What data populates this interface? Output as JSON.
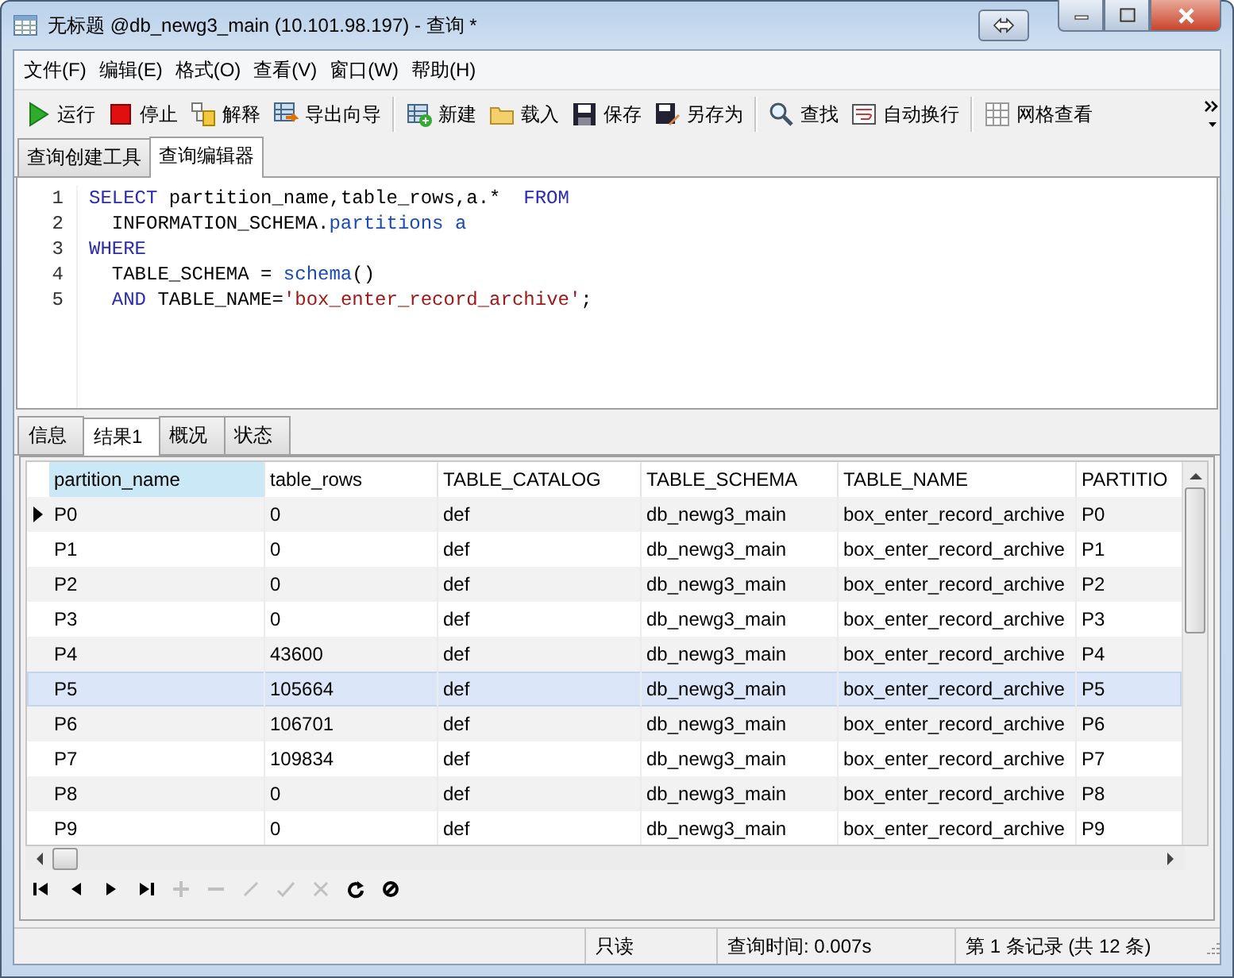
{
  "window": {
    "title": "无标题 @db_newg3_main (10.101.98.197) - 查询 *"
  },
  "menu": [
    "文件(F)",
    "编辑(E)",
    "格式(O)",
    "查看(V)",
    "窗口(W)",
    "帮助(H)"
  ],
  "toolbar": [
    {
      "kind": "run",
      "label": "运行"
    },
    {
      "kind": "stop",
      "label": "停止"
    },
    {
      "kind": "explain",
      "label": "解释"
    },
    {
      "kind": "export",
      "label": "导出向导"
    },
    {
      "kind": "sep"
    },
    {
      "kind": "new",
      "label": "新建"
    },
    {
      "kind": "load",
      "label": "载入"
    },
    {
      "kind": "save",
      "label": "保存"
    },
    {
      "kind": "saveas",
      "label": "另存为"
    },
    {
      "kind": "sep"
    },
    {
      "kind": "find",
      "label": "查找"
    },
    {
      "kind": "wrap",
      "label": "自动换行"
    },
    {
      "kind": "sep"
    },
    {
      "kind": "grid",
      "label": "网格查看"
    }
  ],
  "editor_tabs": [
    {
      "label": "查询创建工具",
      "selected": false
    },
    {
      "label": "查询编辑器",
      "selected": true
    }
  ],
  "editor": {
    "lines": [
      {
        "number": "1",
        "tokens": [
          {
            "kind": "keyword",
            "text": "SELECT"
          },
          {
            "kind": "plain",
            "text": " partition_name,table_rows,a.*  "
          },
          {
            "kind": "keyword",
            "text": "FROM"
          }
        ]
      },
      {
        "number": "2",
        "tokens": [
          {
            "kind": "plain",
            "text": "  INFORMATION_SCHEMA."
          },
          {
            "kind": "func",
            "text": "partitions a"
          }
        ]
      },
      {
        "number": "3",
        "tokens": [
          {
            "kind": "keyword",
            "text": "WHERE"
          }
        ]
      },
      {
        "number": "4",
        "tokens": [
          {
            "kind": "plain",
            "text": "  TABLE_SCHEMA = "
          },
          {
            "kind": "func",
            "text": "schema"
          },
          {
            "kind": "plain",
            "text": "()"
          }
        ]
      },
      {
        "number": "5",
        "tokens": [
          {
            "kind": "keyword",
            "text": "  AND"
          },
          {
            "kind": "plain",
            "text": " TABLE_NAME="
          },
          {
            "kind": "string",
            "text": "'box_enter_record_archive'"
          },
          {
            "kind": "plain",
            "text": ";"
          }
        ]
      }
    ]
  },
  "result_tabs": [
    {
      "label": "信息",
      "selected": false
    },
    {
      "label": "结果1",
      "selected": true
    },
    {
      "label": "概况",
      "selected": false
    },
    {
      "label": "状态",
      "selected": false
    }
  ],
  "table": {
    "columns": [
      {
        "label": "partition_name",
        "selected": true
      },
      {
        "label": "table_rows",
        "selected": false
      },
      {
        "label": "TABLE_CATALOG",
        "selected": false
      },
      {
        "label": "TABLE_SCHEMA",
        "selected": false
      },
      {
        "label": "TABLE_NAME",
        "selected": false
      },
      {
        "label": "PARTITIO",
        "selected": false
      }
    ],
    "rows": [
      {
        "current": true,
        "selected": false,
        "cells": [
          "P0",
          "0",
          "def",
          "db_newg3_main",
          "box_enter_record_archive",
          "P0"
        ]
      },
      {
        "current": false,
        "selected": false,
        "cells": [
          "P1",
          "0",
          "def",
          "db_newg3_main",
          "box_enter_record_archive",
          "P1"
        ]
      },
      {
        "current": false,
        "selected": false,
        "cells": [
          "P2",
          "0",
          "def",
          "db_newg3_main",
          "box_enter_record_archive",
          "P2"
        ]
      },
      {
        "current": false,
        "selected": false,
        "cells": [
          "P3",
          "0",
          "def",
          "db_newg3_main",
          "box_enter_record_archive",
          "P3"
        ]
      },
      {
        "current": false,
        "selected": false,
        "cells": [
          "P4",
          "43600",
          "def",
          "db_newg3_main",
          "box_enter_record_archive",
          "P4"
        ]
      },
      {
        "current": false,
        "selected": true,
        "cells": [
          "P5",
          "105664",
          "def",
          "db_newg3_main",
          "box_enter_record_archive",
          "P5"
        ]
      },
      {
        "current": false,
        "selected": false,
        "cells": [
          "P6",
          "106701",
          "def",
          "db_newg3_main",
          "box_enter_record_archive",
          "P6"
        ]
      },
      {
        "current": false,
        "selected": false,
        "cells": [
          "P7",
          "109834",
          "def",
          "db_newg3_main",
          "box_enter_record_archive",
          "P7"
        ]
      },
      {
        "current": false,
        "selected": false,
        "cells": [
          "P8",
          "0",
          "def",
          "db_newg3_main",
          "box_enter_record_archive",
          "P8"
        ]
      },
      {
        "current": false,
        "selected": false,
        "cells": [
          "P9",
          "0",
          "def",
          "db_newg3_main",
          "box_enter_record_archive",
          "P9"
        ]
      }
    ]
  },
  "navigator": [
    {
      "kind": "first",
      "disabled": false
    },
    {
      "kind": "prev",
      "disabled": false
    },
    {
      "kind": "next",
      "disabled": false
    },
    {
      "kind": "last",
      "disabled": false
    },
    {
      "kind": "add",
      "disabled": true
    },
    {
      "kind": "delete",
      "disabled": true
    },
    {
      "kind": "edit",
      "disabled": true
    },
    {
      "kind": "apply",
      "disabled": true
    },
    {
      "kind": "cancel",
      "disabled": true
    },
    {
      "kind": "refresh",
      "disabled": false
    },
    {
      "kind": "stop",
      "disabled": false
    }
  ],
  "status_bar": [
    "只读",
    "查询时间: 0.007s",
    "第 1 条记录 (共 12 条)"
  ]
}
